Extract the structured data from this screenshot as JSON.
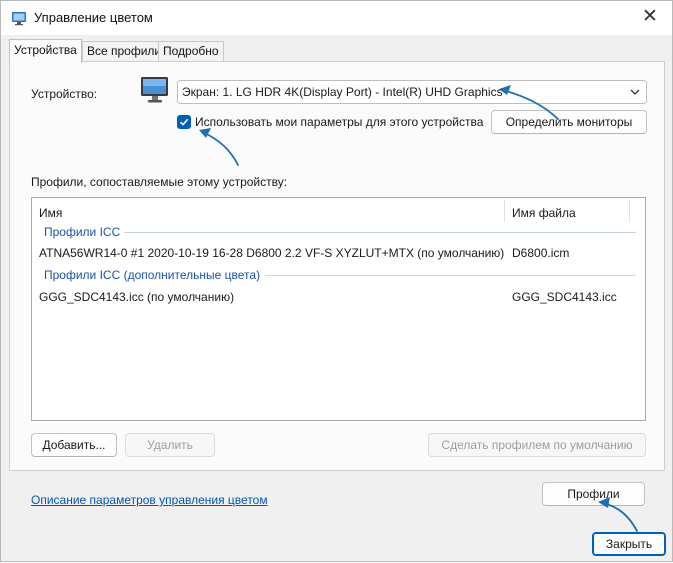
{
  "window": {
    "title": "Управление цветом",
    "close_glyph": "✕"
  },
  "tabs": [
    {
      "label": "Устройства",
      "active": true
    },
    {
      "label": "Все профили",
      "active": false
    },
    {
      "label": "Подробно",
      "active": false
    }
  ],
  "device": {
    "label": "Устройство:",
    "icon": "monitor-icon",
    "selected": "Экран: 1. LG HDR 4K(Display Port) - Intel(R) UHD Graphics",
    "use_settings_label": "Использовать мои параметры для этого устройства",
    "use_settings_checked": true,
    "identify_button": "Определить мониторы"
  },
  "profiles": {
    "section_label": "Профили, сопоставляемые этому устройству:",
    "columns": [
      "Имя",
      "Имя файла"
    ],
    "groups": [
      {
        "title": "Профили ICC",
        "rows": [
          {
            "name": "ATNA56WR14-0 #1 2020-10-19 16-28 D6800 2.2 VF-S XYZLUT+MTX (по умолчанию)",
            "file": "D6800.icm"
          }
        ]
      },
      {
        "title": "Профили ICC (дополнительные цвета)",
        "rows": [
          {
            "name": "GGG_SDC4143.icc (по умолчанию)",
            "file": "GGG_SDC4143.icc"
          }
        ]
      }
    ]
  },
  "buttons": {
    "add": "Добавить...",
    "remove": "Удалить",
    "set_default": "Сделать профилем по умолчанию",
    "profiles": "Профили",
    "close": "Закрыть"
  },
  "footer": {
    "link": "Описание параметров управления цветом"
  },
  "colors": {
    "accent": "#005fb8",
    "link": "#0057b3",
    "group_heading": "#1c53a8",
    "annotation_arrow": "#1e6fb5"
  }
}
